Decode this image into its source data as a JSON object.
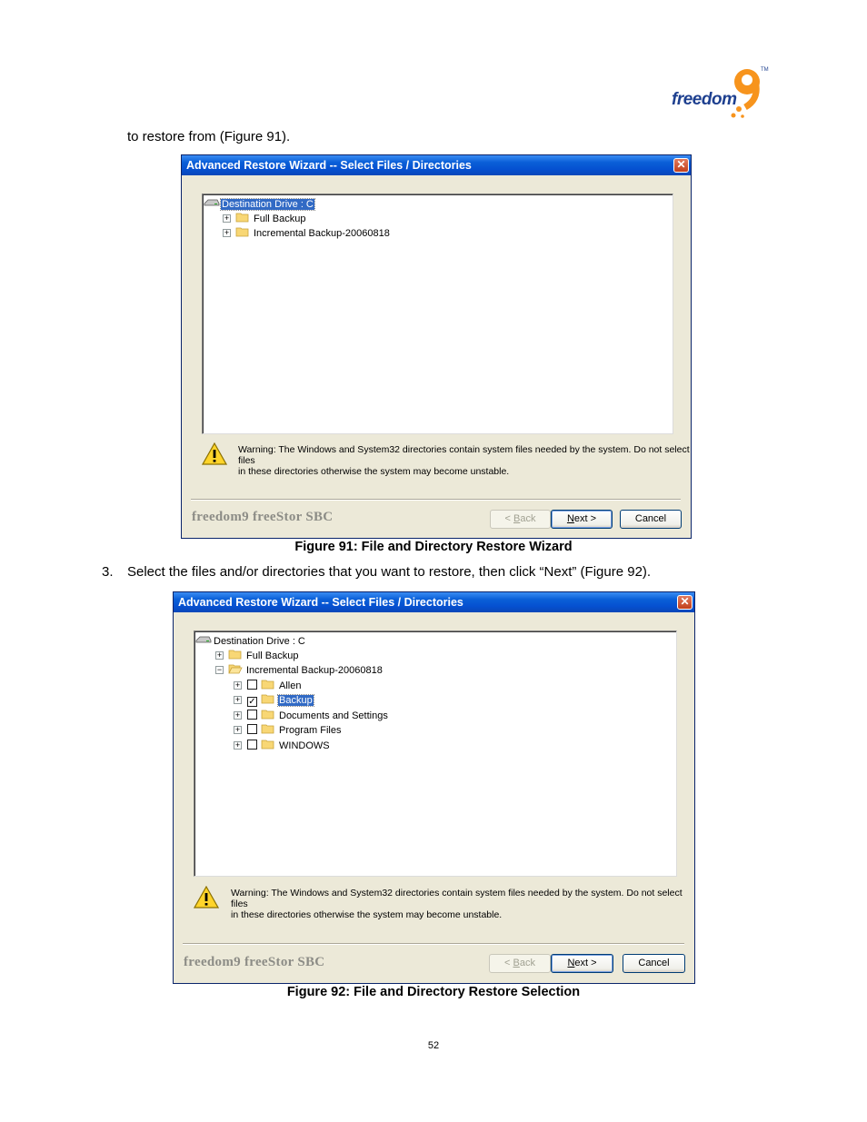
{
  "header": {
    "logo_text": "freedom",
    "logo_tm": "TM"
  },
  "intro_text": "to restore from (Figure 91).",
  "step3_number": "3.",
  "step3_text": "Select the files and/or directories that you want to restore, then click “Next” (Figure 92).",
  "page_number": "52",
  "figure91": {
    "caption": "Figure 91: File and Directory Restore Wizard",
    "dialog": {
      "title": "Advanced Restore Wizard -- Select Files / Directories",
      "close": "✕",
      "tree": {
        "root": "Destination Drive : C",
        "items": [
          "Full Backup",
          "Incremental Backup-20060818"
        ]
      },
      "warning_line1": "Warning: The Windows and System32 directories contain system files needed by the system. Do not select files",
      "warning_line2": "in these directories otherwise the system may become unstable.",
      "brand": "freedom9 freeStor SBC",
      "buttons": {
        "back_prefix": "< ",
        "back_key": "B",
        "back_rest": "ack",
        "next_key": "N",
        "next_rest": "ext >",
        "cancel": "Cancel"
      }
    }
  },
  "figure92": {
    "caption": "Figure 92: File and Directory Restore Selection",
    "dialog": {
      "title": "Advanced Restore Wizard -- Select Files / Directories",
      "close": "✕",
      "tree": {
        "root": "Destination Drive : C",
        "items": [
          "Full Backup",
          "Incremental Backup-20060818"
        ],
        "children": [
          {
            "label": "Allen",
            "checked": false,
            "selected": false
          },
          {
            "label": "Backup",
            "checked": true,
            "selected": true
          },
          {
            "label": "Documents and Settings",
            "checked": false,
            "selected": false
          },
          {
            "label": "Program Files",
            "checked": false,
            "selected": false
          },
          {
            "label": "WINDOWS",
            "checked": false,
            "selected": false
          }
        ],
        "check_mark": "✓"
      },
      "warning_line1": "Warning: The Windows and System32 directories contain system files needed by the system. Do not select files",
      "warning_line2": "in these directories otherwise the system may become unstable.",
      "brand": "freedom9 freeStor SBC",
      "buttons": {
        "back_prefix": "< ",
        "back_key": "B",
        "back_rest": "ack",
        "next_key": "N",
        "next_rest": "ext >",
        "cancel": "Cancel"
      }
    }
  },
  "colors": {
    "titlebar": "#0550d0",
    "dialog_bg": "#ece9d8",
    "selection": "#316ac5",
    "logo_blue": "#1d3f8f",
    "logo_orange": "#f7941d"
  },
  "icons": [
    "drive-icon",
    "folder-icon",
    "warning-icon",
    "close-icon",
    "expand-icon",
    "collapse-icon",
    "checkbox-icon"
  ]
}
